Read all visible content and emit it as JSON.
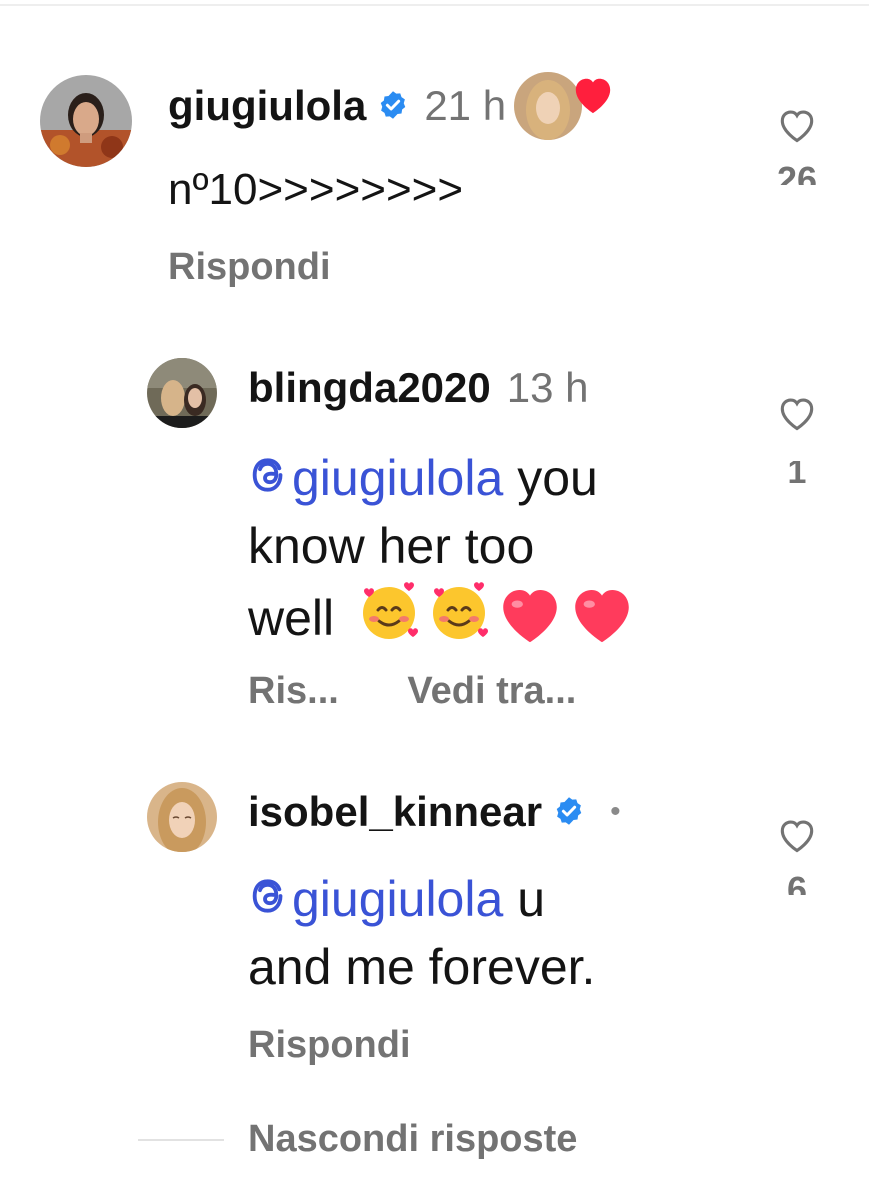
{
  "comments": [
    {
      "username": "giugiulola",
      "verified": true,
      "time": "21 h",
      "liked_by_author": true,
      "text": "nº10>>>>>>>>",
      "like_count": "26",
      "reply_label": "Rispondi"
    },
    {
      "username": "blingda2020",
      "verified": false,
      "time": "13 h",
      "mention": "giugiulola",
      "text_a": "you",
      "text_b": "know her too",
      "text_c": "well",
      "emojis": [
        "smiling-face-with-hearts",
        "smiling-face-with-hearts",
        "red-heart",
        "red-heart"
      ],
      "like_count": "1",
      "reply_label": "Ris...",
      "see_translation_label": "Vedi tra..."
    },
    {
      "username": "isobel_kinnear",
      "verified": true,
      "dot": "•",
      "mention": "giugiulola",
      "text_a": "u",
      "text_b": "and me forever.",
      "like_count": "6",
      "reply_label": "Rispondi"
    }
  ],
  "hide_replies_label": "Nascondi risposte",
  "colors": {
    "mention": "#3a53d6",
    "verified": "#2b8cf2",
    "secondary_text": "#737373",
    "heart_red": "#ff2d44"
  }
}
